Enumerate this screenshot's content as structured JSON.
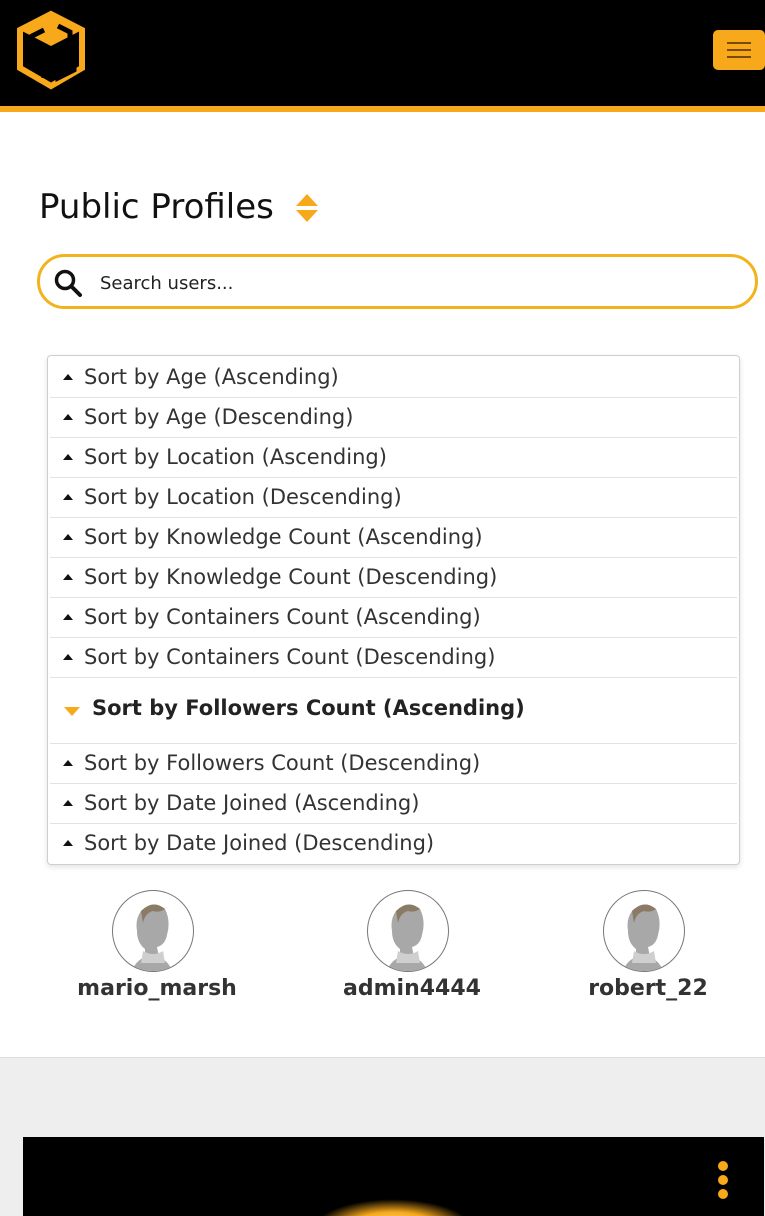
{
  "colors": {
    "accent": "#f7a81b",
    "header_bg": "#000000",
    "footer_bg": "#efeeef"
  },
  "header": {
    "logo_icon": "cg-cube-logo-icon",
    "menu_icon": "hamburger-icon"
  },
  "page": {
    "title": "Public Profiles",
    "sort_icon": "sort-toggle-icon"
  },
  "search": {
    "placeholder": "Search users...",
    "value": "",
    "icon": "search-icon"
  },
  "sort_menu": {
    "selected": "Sort by Followers Count (Ascending)",
    "options": [
      "Sort by Age (Ascending)",
      "Sort by Age (Descending)",
      "Sort by Location (Ascending)",
      "Sort by Location (Descending)",
      "Sort by Knowledge Count (Ascending)",
      "Sort by Knowledge Count (Descending)",
      "Sort by Containers Count (Ascending)",
      "Sort by Containers Count (Descending)",
      "Sort by Followers Count (Ascending)",
      "Sort by Followers Count (Descending)",
      "Sort by Date Joined (Ascending)",
      "Sort by Date Joined (Descending)"
    ]
  },
  "profiles": [
    {
      "username": "mario_marsh",
      "avatar": "default-head-avatar"
    },
    {
      "username": "admin4444",
      "avatar": "default-head-avatar"
    },
    {
      "username": "robert_22",
      "avatar": "default-head-avatar"
    }
  ],
  "footer": {
    "menu_icon": "kebab-icon"
  }
}
